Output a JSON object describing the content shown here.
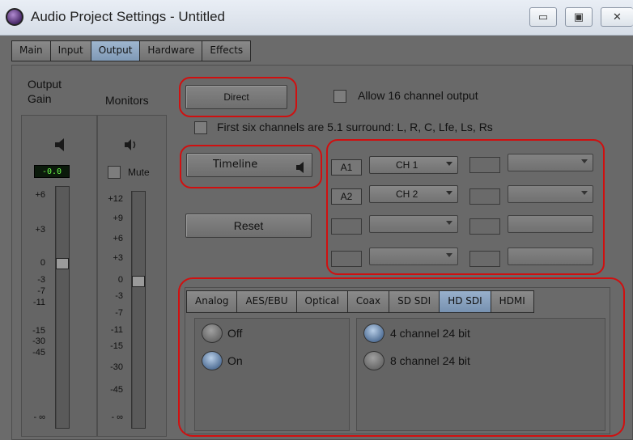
{
  "window": {
    "title": "Audio Project Settings - Untitled",
    "controls": {
      "minimize": "▭",
      "maximize": "▣",
      "close": "✕"
    }
  },
  "tabs": [
    "Main",
    "Input",
    "Output",
    "Hardware",
    "Effects"
  ],
  "active_tab": "Output",
  "meters": {
    "output_gain_label_1": "Output",
    "output_gain_label_2": "Gain",
    "monitors_label": "Monitors",
    "gain_readout": "-0.0",
    "mute_label": "Mute",
    "gain_ticks": [
      "+6",
      "+3",
      "0",
      "-3",
      "-7",
      "-11",
      "-15",
      "-30",
      "-45",
      "- ∞"
    ],
    "monitor_ticks": [
      "+12",
      "+9",
      "+6",
      "+3",
      "0",
      "-3",
      "-7",
      "-11",
      "-15",
      "-30",
      "-45",
      "- ∞"
    ],
    "speaker_icon": "speaker-icon"
  },
  "output": {
    "direct_label": "Direct",
    "allow16_label": "Allow 16 channel output",
    "surround_label": "First six channels are 5.1 surround: L, R, C, Lfe, Ls, Rs",
    "timeline_label": "Timeline",
    "reset_label": "Reset",
    "channels": [
      {
        "track": "A1",
        "channel": "CH 1"
      },
      {
        "track": "A2",
        "channel": "CH 2"
      }
    ]
  },
  "hardware_tabs": [
    "Analog",
    "AES/EBU",
    "Optical",
    "Coax",
    "SD SDI",
    "HD SDI",
    "HDMI"
  ],
  "active_hardware_tab": "HD SDI",
  "power": {
    "off_label": "Off",
    "on_label": "On",
    "selected": "On"
  },
  "bit_mode": {
    "option_4": "4 channel 24 bit",
    "option_8": "8 channel 24 bit",
    "selected": "4 channel 24 bit"
  },
  "colors": {
    "highlight": "#d01010",
    "active_tab": "#8aa4c2"
  }
}
